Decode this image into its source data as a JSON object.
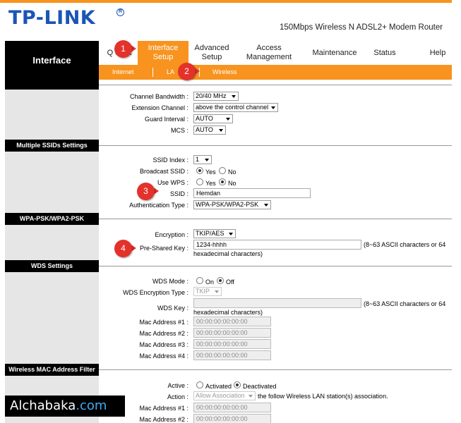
{
  "header": {
    "logo_text": "TP-LINK",
    "registered_mark": "R",
    "model": "150Mbps Wireless N ADSL2+ Modem Router"
  },
  "sidebar": {
    "title": "Interface"
  },
  "nav": [
    {
      "label": "Quick Start",
      "visible_label": "Q Start"
    },
    {
      "label": "Interface Setup"
    },
    {
      "label": "Advanced Setup"
    },
    {
      "label": "Access Management"
    },
    {
      "label": "Maintenance"
    },
    {
      "label": "Status"
    },
    {
      "label": "Help"
    }
  ],
  "subnav": [
    {
      "label": "Internet"
    },
    {
      "label": "LA"
    },
    {
      "label": "Wireless"
    }
  ],
  "sections": {
    "multiple_ssids": "Multiple SSIDs Settings",
    "wpa": "WPA-PSK/WPA2-PSK",
    "wds": "WDS Settings",
    "mac_filter": "Wireless MAC Address Filter"
  },
  "radio_settings": {
    "channel_bandwidth": {
      "label": "Channel Bandwidth :",
      "value": "20/40 MHz"
    },
    "extension_channel": {
      "label": "Extension Channel :",
      "value": "above the control channel"
    },
    "guard_interval": {
      "label": "Guard Interval :",
      "value": "AUTO"
    },
    "mcs": {
      "label": "MCS :",
      "value": "AUTO"
    }
  },
  "ssid_settings": {
    "ssid_index": {
      "label": "SSID Index :",
      "value": "1"
    },
    "broadcast_ssid": {
      "label": "Broadcast SSID :",
      "yes": "Yes",
      "no": "No",
      "selected": "yes"
    },
    "use_wps": {
      "label": "Use WPS :",
      "yes": "Yes",
      "no": "No",
      "selected": "no"
    },
    "ssid": {
      "label": "SSID :",
      "value": "Hemdan"
    },
    "auth_type": {
      "label": "Authentication Type :",
      "value": "WPA-PSK/WPA2-PSK"
    }
  },
  "wpa_settings": {
    "encryption": {
      "label": "Encryption :",
      "value": "TKIP/AES"
    },
    "psk": {
      "label": "Pre-Shared Key :",
      "value": "1234-hhhh",
      "hint1": "(8~63 ASCII characters or 64",
      "hint2": "hexadecimal characters)"
    }
  },
  "wds_settings": {
    "mode": {
      "label": "WDS Mode :",
      "on": "On",
      "off": "Off",
      "selected": "off"
    },
    "encryption_type": {
      "label": "WDS Encryption Type :",
      "value": "TKIP"
    },
    "key": {
      "label": "WDS Key :",
      "value": "",
      "hint1": "(8~63 ASCII characters or 64",
      "hint2": "hexadecimal characters)"
    },
    "macs": [
      {
        "label": "Mac Address #1 :",
        "value": "00:00:00:00:00:00"
      },
      {
        "label": "Mac Address #2 :",
        "value": "00:00:00:00:00:00"
      },
      {
        "label": "Mac Address #3 :",
        "value": "00:00:00:00:00:00"
      },
      {
        "label": "Mac Address #4 :",
        "value": "00:00:00:00:00:00"
      }
    ]
  },
  "mac_filter": {
    "active": {
      "label": "Active :",
      "activated": "Activated",
      "deactivated": "Deactivated",
      "selected": "deactivated"
    },
    "action": {
      "label": "Action :",
      "value": "Allow Association",
      "suffix": "the follow Wireless LAN station(s) association."
    },
    "macs": [
      {
        "label": "Mac Address #1 :",
        "value": "00:00:00:00:00:00"
      },
      {
        "label": "Mac Address #2 :",
        "value": "00:00:00:00:00:00"
      }
    ]
  },
  "markers": [
    "1",
    "2",
    "3",
    "4"
  ],
  "watermark": {
    "name": "Alchabaka",
    "tld": ".com"
  },
  "colors": {
    "accent": "#f7931e",
    "logo": "#1b55b7",
    "marker": "#e4312a",
    "section": "#000000"
  }
}
